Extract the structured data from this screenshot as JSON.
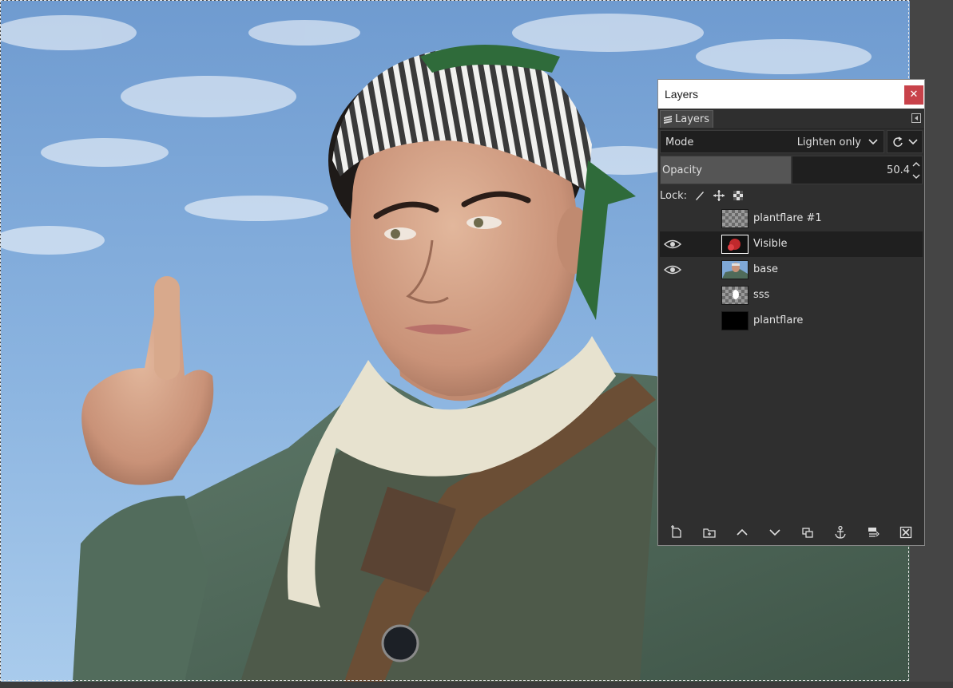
{
  "dock": {
    "title": "Layers",
    "tab_label": "Layers",
    "mode_label": "Mode",
    "mode_value": "Lighten only",
    "opacity_label": "Opacity",
    "opacity_value": "50.4",
    "opacity_fraction": 0.504,
    "lock_label": "Lock:"
  },
  "layers": [
    {
      "name": "plantflare #1",
      "visible": false,
      "selected": false,
      "thumb": "transparent"
    },
    {
      "name": "Visible",
      "visible": true,
      "selected": true,
      "thumb": "flare-dark"
    },
    {
      "name": "base",
      "visible": true,
      "selected": false,
      "thumb": "photo"
    },
    {
      "name": "sss",
      "visible": false,
      "selected": false,
      "thumb": "mask-transparent"
    },
    {
      "name": "plantflare",
      "visible": false,
      "selected": false,
      "thumb": "black"
    }
  ],
  "colors": {
    "dock_bg": "#2f2f2f",
    "selected_row": "#1f1f1f",
    "close_button": "#c8424a",
    "sky": "#6f9bd0"
  },
  "icons": {
    "tab": "layers-stack-icon",
    "dock_menu": "dock-menu-icon",
    "lock": [
      "lock-pixels-brush-icon",
      "lock-position-move-icon",
      "lock-alpha-checker-icon"
    ],
    "toolbar": [
      "new-layer-icon",
      "new-layer-group-icon",
      "raise-layer-icon",
      "lower-layer-icon",
      "duplicate-layer-icon",
      "anchor-layer-icon",
      "merge-layer-icon",
      "delete-layer-icon"
    ]
  }
}
